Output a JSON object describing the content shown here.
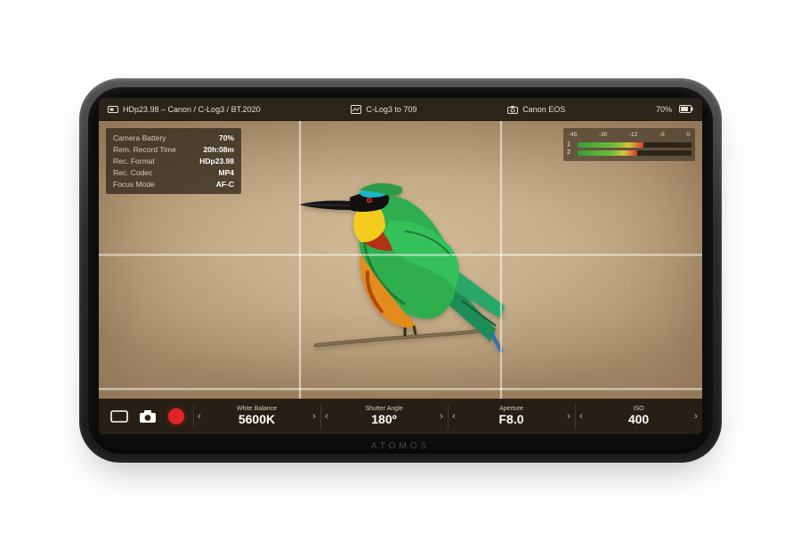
{
  "brand": "ATOMOS",
  "topbar": {
    "mode_icon": "video-format-icon",
    "format_line": "HDp23.98 – Canon / C-Log3 / BT.2020",
    "lut_icon": "lut-icon",
    "lut_line": "C-Log3 to 709",
    "camera_icon": "camera-icon",
    "camera_line": "Canon EOS",
    "battery_pct": "70%"
  },
  "info_panel": {
    "rows": [
      {
        "label": "Camera Battery",
        "value": "70%"
      },
      {
        "label": "Rem. Record Time",
        "value": "20h:08m",
        "small_suffix": true
      },
      {
        "label": "Rec. Format",
        "value": "HDp23.98"
      },
      {
        "label": "Rec. Codec",
        "value": "MP4"
      },
      {
        "label": "Focus Mode",
        "value": "AF-C"
      }
    ]
  },
  "audio_meters": {
    "ticks": [
      "-45",
      "-30",
      "-12",
      "-6",
      "0"
    ],
    "channels": [
      {
        "name": "1",
        "level_pct": 58
      },
      {
        "name": "2",
        "level_pct": 52
      }
    ]
  },
  "bottombar": {
    "crop_icon": "crop-icon",
    "still_icon": "camera-icon",
    "record_icon": "record-icon",
    "params": [
      {
        "name": "White Balance",
        "value": "5600K"
      },
      {
        "name": "Shutter Angle",
        "value": "180º"
      },
      {
        "name": "Aperture",
        "value": "F8.0"
      },
      {
        "name": "ISO",
        "value": "400"
      }
    ]
  },
  "subject": {
    "description": "Colorful bee-eater bird perched on a thin branch",
    "bg_color": "#c7ae8a"
  }
}
